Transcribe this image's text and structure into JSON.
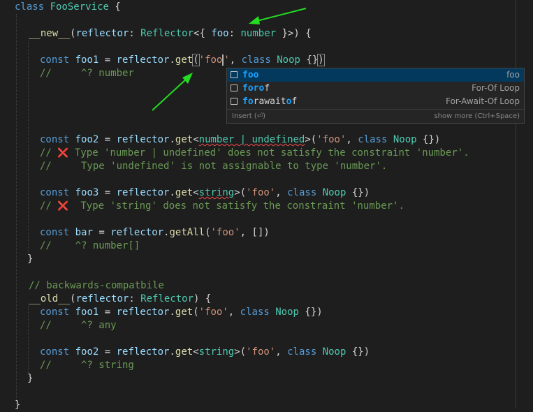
{
  "code": {
    "class_header": {
      "kw": "class",
      "name": "FooService",
      "brace": " {"
    },
    "new_sig": {
      "name": "__new__",
      "open": "(",
      "param": "reflector",
      "colon": ": ",
      "type": "Reflector",
      "rest1": "<{ ",
      "prop": "foo",
      "colon2": ": ",
      "ptype": "number",
      "rest2": " }>) {"
    },
    "line_foo1": {
      "kw": "const",
      "var": "foo1",
      "eq": " = ",
      "obj": "reflector",
      "dot": ".",
      "method": "get",
      "open": "(",
      "str": "'foo",
      "str_end": "'",
      "comma": ", ",
      "kw2": "class",
      "cls": "Noop",
      "end": " {}",
      "close": ")"
    },
    "hint_foo1": "//     ^? number",
    "line_foo2": {
      "kw": "const",
      "var": "foo2",
      "eq": " = ",
      "obj": "reflector",
      "dot": ".",
      "method": "get",
      "lt": "<",
      "targ": "number | undefined",
      "gt": ">",
      "open": "(",
      "str": "'foo'",
      "comma": ", ",
      "kw2": "class",
      "cls": "Noop",
      "end": " {})"
    },
    "err_foo2_a_prefix": "// ",
    "err_foo2_a": " Type 'number | undefined' does not satisfy the constraint 'number'.",
    "err_foo2_b": "//     Type 'undefined' is not assignable to type 'number'.",
    "line_foo3": {
      "kw": "const",
      "var": "foo3",
      "eq": " = ",
      "obj": "reflector",
      "dot": ".",
      "method": "get",
      "lt": "<",
      "targ": "string",
      "gt": ">",
      "open": "(",
      "str": "'foo'",
      "comma": ", ",
      "kw2": "class",
      "cls": "Noop",
      "end": " {})"
    },
    "err_foo3_prefix": "// ",
    "err_foo3": "  Type 'string' does not satisfy the constraint 'number'.",
    "error_glyph": "❌",
    "line_bar": {
      "kw": "const",
      "var": "bar",
      "eq": " = ",
      "obj": "reflector",
      "dot": ".",
      "method": "getAll",
      "open": "(",
      "str": "'foo'",
      "rest": ", [])"
    },
    "hint_bar": "//    ^? number[]",
    "close_brace_1": "}",
    "comment_compat": "// backwards-compatbile",
    "old_sig": {
      "name": "__old__",
      "open": "(",
      "param": "reflector",
      "colon": ": ",
      "type": "Reflector",
      "rest": ") {"
    },
    "line_old_foo1": {
      "kw": "const",
      "var": "foo1",
      "eq": " = ",
      "obj": "reflector",
      "dot": ".",
      "method": "get",
      "open": "(",
      "str": "'foo'",
      "comma": ", ",
      "kw2": "class",
      "cls": "Noop",
      "end": " {})"
    },
    "hint_old_foo1": "//     ^? any",
    "line_old_foo2": {
      "kw": "const",
      "var": "foo2",
      "eq": " = ",
      "obj": "reflector",
      "dot": ".",
      "method": "get",
      "lt": "<",
      "targ": "string",
      "gt": ">",
      "open": "(",
      "str": "'foo'",
      "comma": ", ",
      "kw2": "class",
      "cls": "Noop",
      "end": " {})"
    },
    "hint_old_foo2": "//     ^? string",
    "close_brace_2": "}",
    "close_brace_3": "}"
  },
  "suggest": {
    "items": [
      {
        "pre": "",
        "m1": "foo",
        "mid": "",
        "m2": "",
        "post": "",
        "detail": "foo",
        "selected": true
      },
      {
        "pre": "",
        "m1": "for",
        "mid": "",
        "m2": "o",
        "post": "f",
        "detail": "For-Of Loop",
        "selected": false
      },
      {
        "pre": "",
        "m1": "fo",
        "mid": "rawait",
        "m2": "o",
        "post": "f",
        "detail": "For-Await-Of Loop",
        "selected": false
      }
    ],
    "footer_left": "Insert (⏎)",
    "footer_right": "show more (Ctrl+Space)"
  },
  "colors": {
    "annotation_arrow": "#22dd22",
    "keyword": "#569cd6",
    "type": "#4ec9b0",
    "string": "#ce9178",
    "comment": "#6a9955",
    "error": "#f14c4c",
    "match": "#18a3ff"
  }
}
